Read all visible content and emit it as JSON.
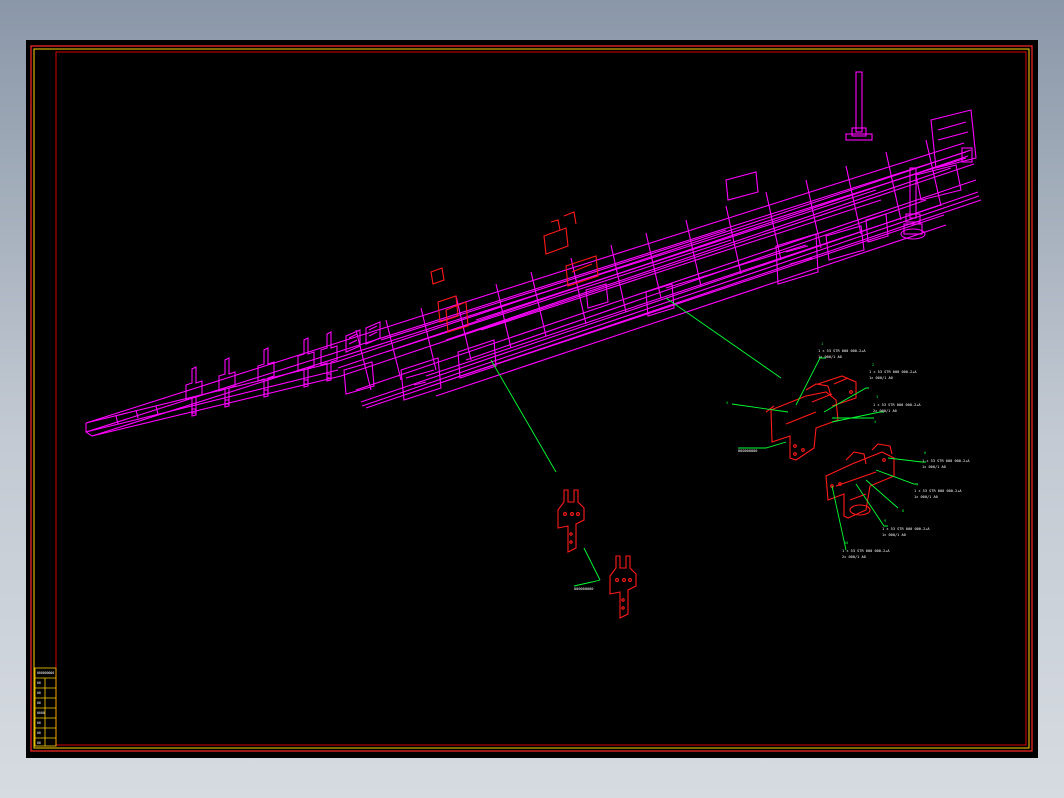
{
  "drawing": {
    "background": "#000000",
    "colors": {
      "frame_outer": "#ff2a2a",
      "frame_inner": "#ffd200",
      "assembly": "#ff00ff",
      "detail_parts": "#ff1a1a",
      "leaders": "#00ff33"
    },
    "views": [
      "isometric-frame-assembly",
      "detail-group-a",
      "detail-group-b",
      "detail-group-c"
    ]
  },
  "labels": {
    "a1_tag": "1",
    "a1_l1": "1 × 53 STR 000 000-2+A",
    "a1_l2": "1× 000/1 A0",
    "a2_tag": "2",
    "a2_l1": "1 × 53 STR 000 000-2+A",
    "a2_l2": "1× 000/1 A0",
    "a3_tag": "3",
    "a3_l1": "1 × 53 STR 000 000-2+A",
    "a3_l2": "2× 000/1 A0",
    "a4_tag": "4",
    "a_left_tag": "5",
    "a_bottom": "000000000",
    "b1_tag": "6",
    "b1_l1": "1 × 53 STR 000 000-2+A",
    "b1_l2": "1× 000/1 A0",
    "b2_tag": "7",
    "b2_l1": "1 × 53 STR 000 000-2+A",
    "b2_l2": "1× 000/1 A0",
    "b3_tag": "8",
    "b4_tag": "9",
    "b4_l1": "1 × 53 STR 000 000-2+A",
    "b4_l2": "1× 000/1 A0",
    "b5_tag": "10",
    "b5_l1": "1 × 53 STR 000 000-2+A",
    "b5_l2": "2× 000/1 A0",
    "c_label": "000000000"
  },
  "title_block": {
    "rows": [
      "000000000",
      "00",
      "00",
      "00",
      "0000",
      "00",
      "00",
      "00"
    ]
  }
}
